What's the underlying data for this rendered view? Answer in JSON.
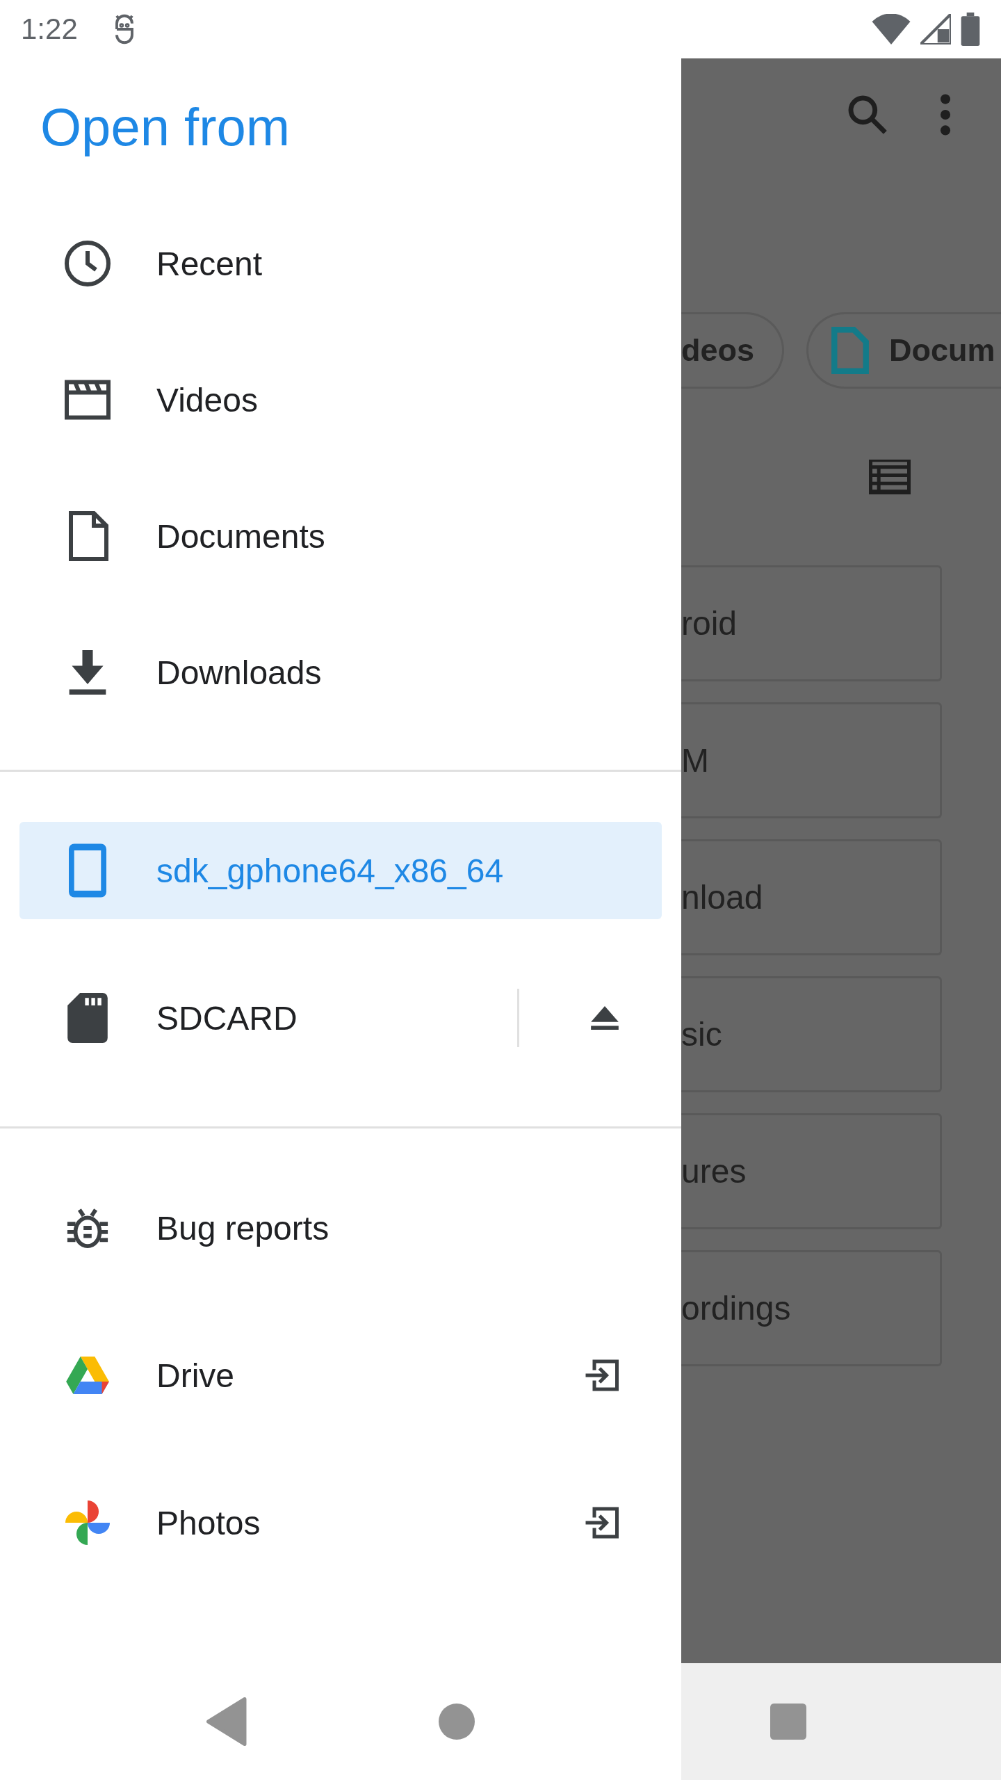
{
  "status_bar": {
    "time": "1:22"
  },
  "drawer": {
    "title": "Open from",
    "sections": [
      {
        "items": [
          {
            "kind": "recent",
            "label": "Recent",
            "selected": false
          },
          {
            "kind": "videos",
            "label": "Videos",
            "selected": false
          },
          {
            "kind": "documents",
            "label": "Documents",
            "selected": false
          },
          {
            "kind": "downloads",
            "label": "Downloads",
            "selected": false
          }
        ]
      },
      {
        "items": [
          {
            "kind": "phone",
            "label": "sdk_gphone64_x86_64",
            "selected": true
          },
          {
            "kind": "sdcard",
            "label": "SDCARD",
            "selected": false,
            "ejectable": true
          }
        ]
      },
      {
        "items": [
          {
            "kind": "bug",
            "label": "Bug reports",
            "selected": false
          },
          {
            "kind": "drive",
            "label": "Drive",
            "selected": false,
            "external": true
          },
          {
            "kind": "photos",
            "label": "Photos",
            "selected": false,
            "external": true
          }
        ]
      }
    ]
  },
  "background": {
    "chips": [
      {
        "label": "deos",
        "kind": "plain"
      },
      {
        "label": "Docum",
        "kind": "document"
      }
    ],
    "folders": [
      "roid",
      "M",
      "nload",
      "sic",
      "ures",
      "ordings"
    ]
  }
}
